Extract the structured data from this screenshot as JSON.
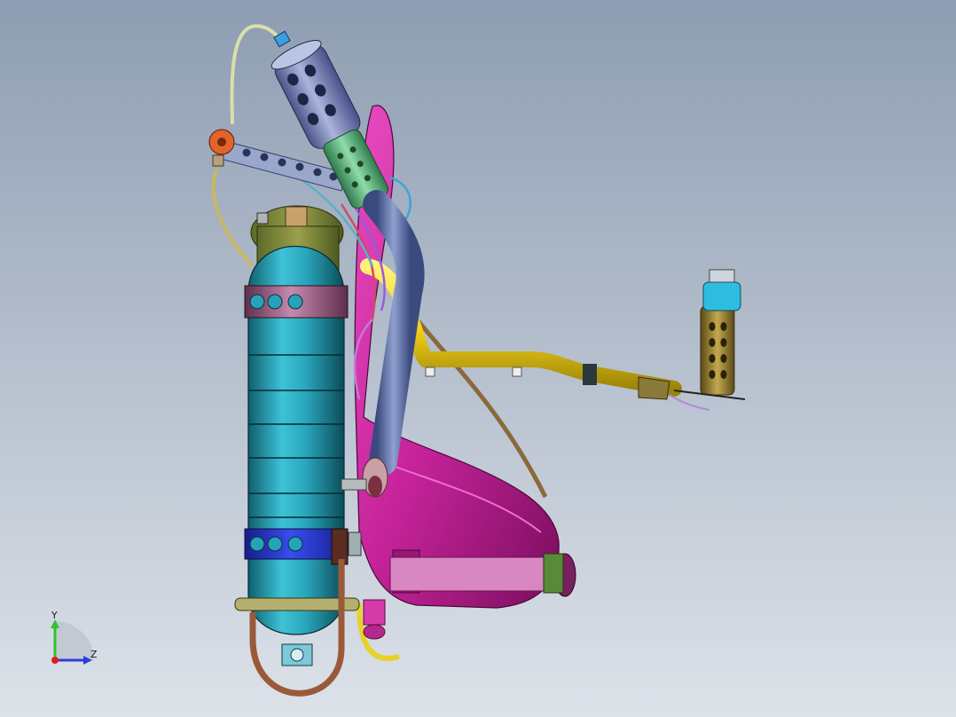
{
  "view": {
    "background_top": "#8e9db2",
    "background_bottom": "#dde2e9"
  },
  "triad": {
    "y_label": "Y",
    "z_label": "Z",
    "y_color": "#2ec42e",
    "z_color": "#2b3fd8",
    "x_color": "#e02020"
  },
  "colors": {
    "tank": "#2aa6bb",
    "tank_band": "#b86e98",
    "tank_band_lower": "#2a38d8",
    "frame": "#c6239a",
    "exhaust": "#6d80b4",
    "muffler": "#7a86b8",
    "muffler_sleeve": "#6fc78f",
    "fuel_line": "#f2d21a",
    "nozzle": "#a08a35",
    "nozzle_cap": "#2ebde0",
    "bracket": "#9aa7cc",
    "valve": "#e2642b",
    "copper_pipe": "#9a5a3a"
  }
}
